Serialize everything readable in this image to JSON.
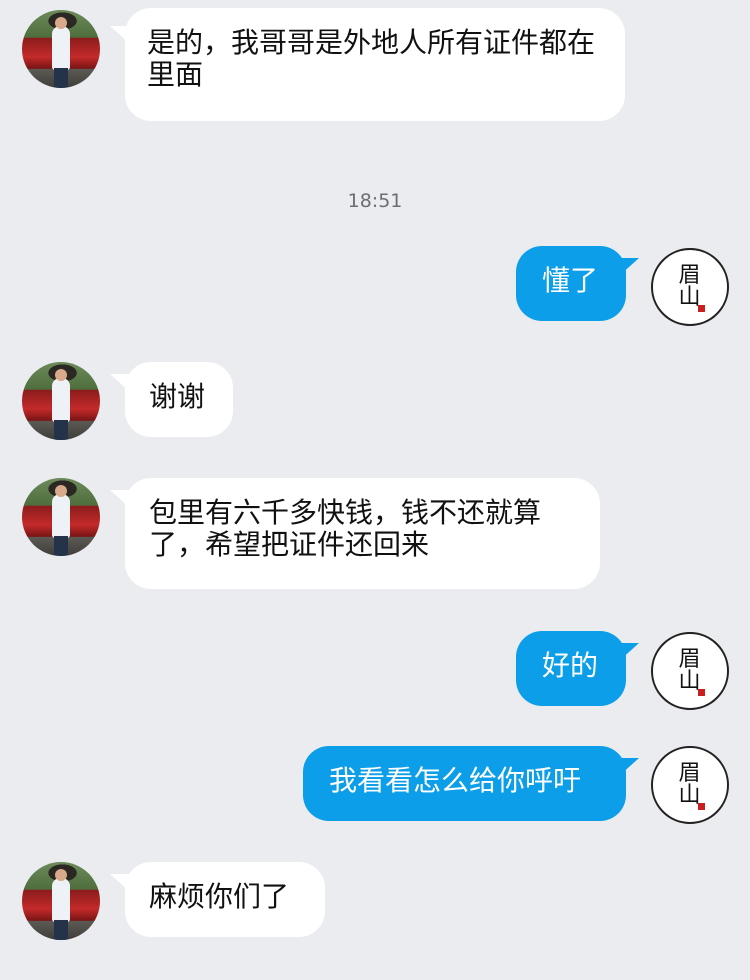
{
  "colors": {
    "background": "#ebecf0",
    "incoming_bubble": "#ffffff",
    "outgoing_bubble": "#0c9ee8",
    "outgoing_text": "#ffffff",
    "timestamp_text": "#6b6e74"
  },
  "self_avatar": {
    "seal_line1": "眉",
    "seal_line2": "山"
  },
  "timestamp": "18:51",
  "messages": [
    {
      "sender": "other",
      "text": "是的，我哥哥是外地人所有证件都在里面"
    },
    {
      "sender": "self",
      "text": "懂了"
    },
    {
      "sender": "other",
      "text": "谢谢"
    },
    {
      "sender": "other",
      "text": "包里有六千多快钱，钱不还就算了，希望把证件还回来"
    },
    {
      "sender": "self",
      "text": "好的"
    },
    {
      "sender": "self",
      "text": "我看看怎么给你呼吁"
    },
    {
      "sender": "other",
      "text": "麻烦你们了"
    }
  ]
}
